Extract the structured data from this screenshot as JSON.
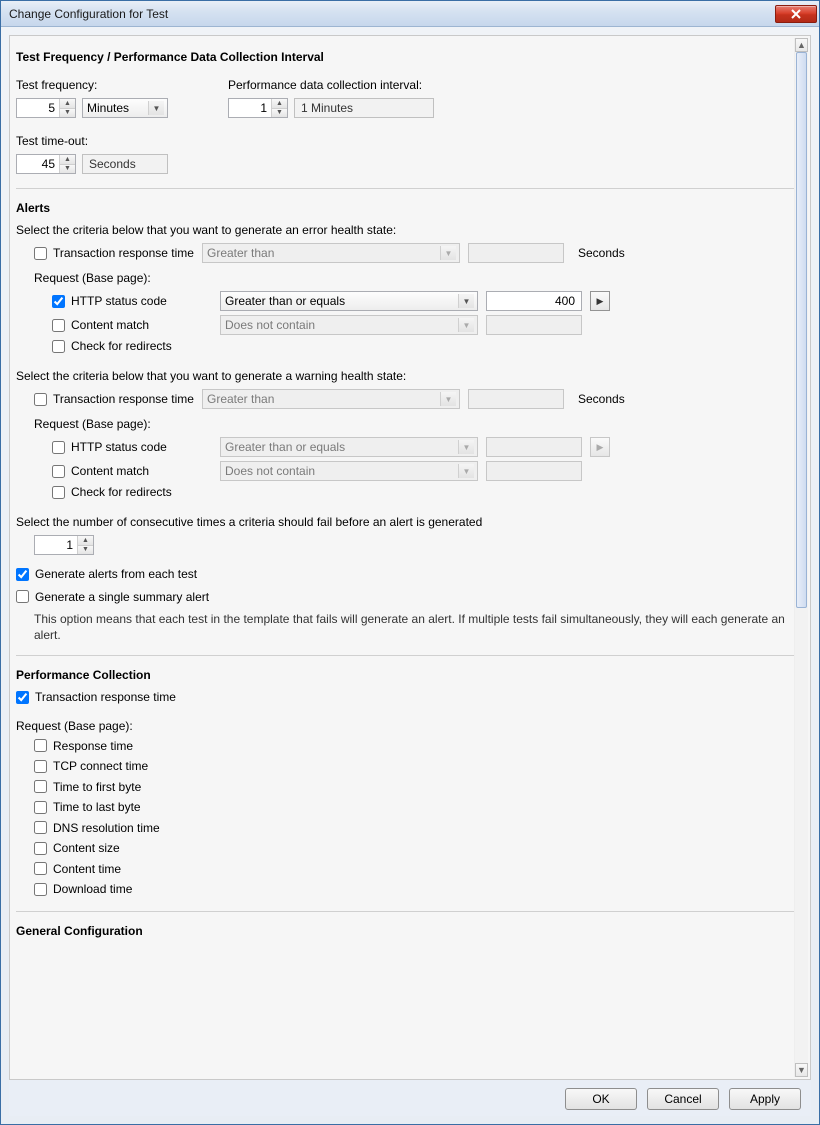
{
  "window": {
    "title": "Change Configuration for Test"
  },
  "sections": {
    "frequency": {
      "heading": "Test Frequency / Performance Data Collection Interval",
      "test_frequency_label": "Test frequency:",
      "test_frequency_value": "5",
      "test_frequency_unit": "Minutes",
      "perf_label": "Performance data collection interval:",
      "perf_value": "1",
      "perf_display": "1 Minutes",
      "timeout_label": "Test time-out:",
      "timeout_value": "45",
      "timeout_unit": "Seconds"
    },
    "alerts": {
      "heading": "Alerts",
      "error_intro": "Select the criteria below that you want to generate an error health state:",
      "warning_intro": "Select the criteria below that you want to generate a warning health state:",
      "request_label": "Request (Base page):",
      "rows": {
        "trt": "Transaction response time",
        "http": "HTTP status code",
        "content": "Content match",
        "redirects": "Check for redirects"
      },
      "ops": {
        "gt": "Greater than",
        "gte": "Greater than or equals",
        "dnc": "Does not contain"
      },
      "units": {
        "seconds": "Seconds"
      },
      "http_value_error": "400",
      "consecutive_label": "Select the number of consecutive times a criteria should fail before an alert is generated",
      "consecutive_value": "1",
      "gen_each": "Generate alerts from each test",
      "gen_summary": "Generate a single summary alert",
      "note": "This option means that each test in the template that fails will generate an alert. If multiple tests fail simultaneously, they will each generate an alert."
    },
    "perf": {
      "heading": "Performance Collection",
      "trt": "Transaction response time",
      "request_label": "Request (Base page):",
      "items": {
        "response": "Response time",
        "tcp": "TCP connect time",
        "ttfb": "Time to first byte",
        "ttlb": "Time to last byte",
        "dns": "DNS resolution time",
        "csize": "Content size",
        "ctime": "Content time",
        "download": "Download time"
      }
    },
    "general": {
      "heading": "General Configuration"
    }
  },
  "buttons": {
    "ok": "OK",
    "cancel": "Cancel",
    "apply": "Apply"
  }
}
